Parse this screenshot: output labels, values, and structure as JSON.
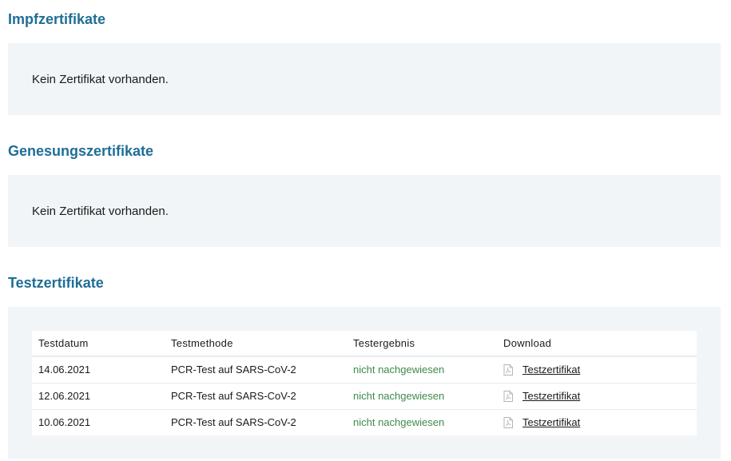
{
  "sections": {
    "impf": {
      "title": "Impfzertifikate",
      "empty_text": "Kein Zertifikat vorhanden."
    },
    "genesung": {
      "title": "Genesungszertifikate",
      "empty_text": "Kein Zertifikat vorhanden."
    },
    "test": {
      "title": "Testzertifikate",
      "table": {
        "headers": {
          "date": "Testdatum",
          "method": "Testmethode",
          "result": "Testergebnis",
          "download": "Download"
        },
        "rows": [
          {
            "date": "14.06.2021",
            "method": "PCR-Test auf SARS-CoV-2",
            "result": "nicht nachgewiesen",
            "download_label": "Testzertifikat",
            "icon": "pdf-file-icon"
          },
          {
            "date": "12.06.2021",
            "method": "PCR-Test auf SARS-CoV-2",
            "result": "nicht nachgewiesen",
            "download_label": "Testzertifikat",
            "icon": "pdf-file-icon"
          },
          {
            "date": "10.06.2021",
            "method": "PCR-Test auf SARS-CoV-2",
            "result": "nicht nachgewiesen",
            "download_label": "Testzertifikat",
            "icon": "pdf-file-icon"
          }
        ]
      }
    }
  },
  "colors": {
    "heading": "#1f6e96",
    "panel_bg": "#f1f5f8",
    "result_text": "#3d8a4b"
  }
}
